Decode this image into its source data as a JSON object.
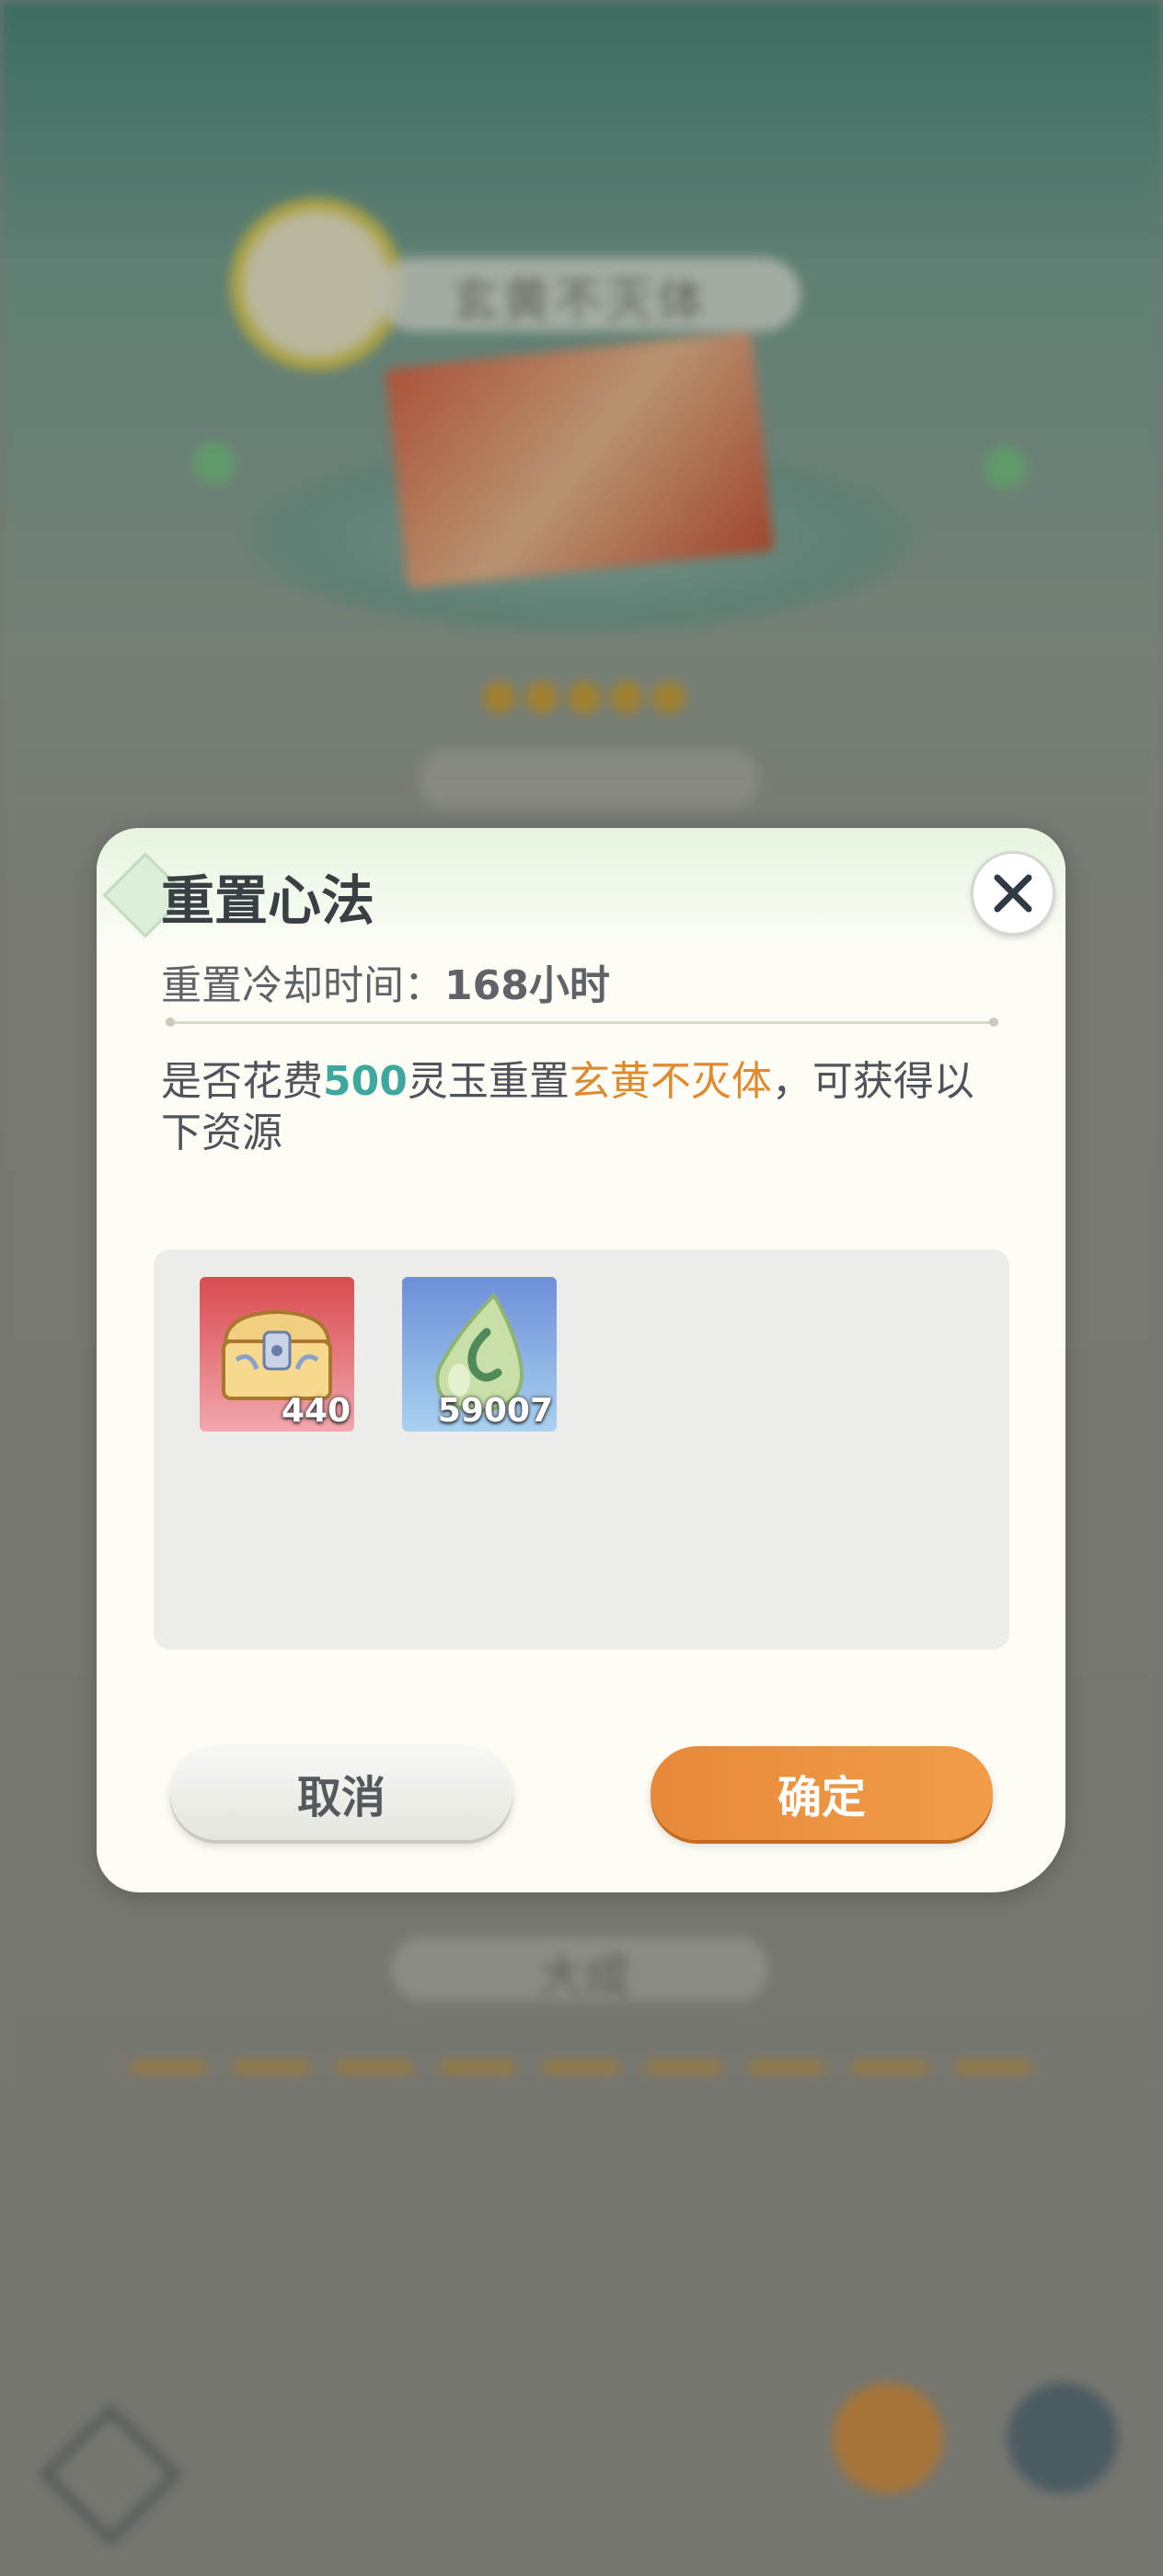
{
  "background": {
    "technique_title": "玄黄不灭体",
    "rank_label": "大成"
  },
  "dialog": {
    "title": "重置心法",
    "cooldown_label": "重置冷却时间：",
    "cooldown_value": "168小时",
    "message": {
      "part1": "是否花费",
      "cost": "500",
      "part2": "灵玉重置",
      "technique": "玄黄不灭体",
      "part3": "，可获得以下资源"
    },
    "rewards": [
      {
        "icon": "treasure-chest-icon",
        "count": "440"
      },
      {
        "icon": "jade-droplet-icon",
        "count": "59007"
      }
    ],
    "cancel_label": "取消",
    "confirm_label": "确定"
  },
  "colors": {
    "accent_teal": "#3ea79e",
    "accent_orange": "#e08a2f",
    "confirm_button": "#e7893a"
  }
}
